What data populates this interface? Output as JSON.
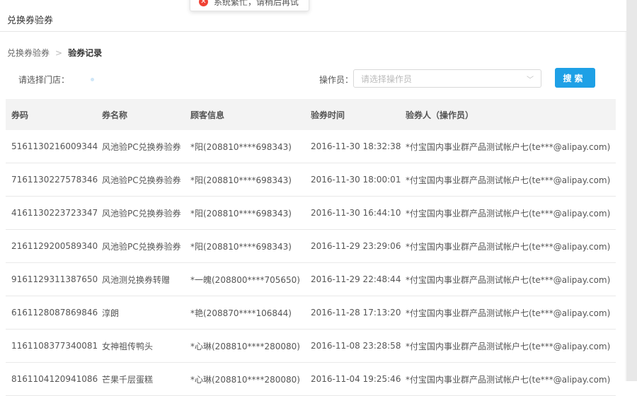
{
  "page": {
    "title": "兑换券验券",
    "toast": {
      "icon": "error-icon",
      "message": "系统繁忙，请稍后再试"
    }
  },
  "breadcrumb": {
    "parent": "兑换券验券",
    "separator": ">",
    "current": "验券记录"
  },
  "filters": {
    "store_label": "请选择门店：",
    "operator_label": "操作员：",
    "operator_placeholder": "请选择操作员",
    "search_label": "搜索"
  },
  "table": {
    "columns": [
      "券码",
      "券名称",
      "顾客信息",
      "验券时间",
      "验券人（操作员）"
    ],
    "rows": [
      [
        "5161130216009344",
        "风池验PC兑换券验券",
        "*阳(208810****698343)",
        "2016-11-30 18:32:38",
        "*付宝国内事业群产品测试帐户七(te***@alipay.com)"
      ],
      [
        "7161130227578346",
        "风池验PC兑换券验券",
        "*阳(208810****698343)",
        "2016-11-30 18:00:01",
        "*付宝国内事业群产品测试帐户七(te***@alipay.com)"
      ],
      [
        "4161130223723347",
        "风池验PC兑换券验券",
        "*阳(208810****698343)",
        "2016-11-30 16:44:10",
        "*付宝国内事业群产品测试帐户七(te***@alipay.com)"
      ],
      [
        "2161129200589340",
        "风池验PC兑换券验券",
        "*阳(208810****698343)",
        "2016-11-29 23:29:06",
        "*付宝国内事业群产品测试帐户七(te***@alipay.com)"
      ],
      [
        "9161129311387650",
        "风池测兑换券转赠",
        "*一魄(208800****705650)",
        "2016-11-29 22:48:44",
        "*付宝国内事业群产品测试帐户七(te***@alipay.com)"
      ],
      [
        "6161128087869846",
        "淳朗",
        "*艳(208870****106844)",
        "2016-11-28 17:13:20",
        "*付宝国内事业群产品测试帐户七(te***@alipay.com)"
      ],
      [
        "1161108377340081",
        "女神祖传鸭头",
        "*心琳(208810****280080)",
        "2016-11-08 23:28:58",
        "*付宝国内事业群产品测试帐户七(te***@alipay.com)"
      ],
      [
        "8161104120941086",
        "芒果千层蛋糕",
        "*心琳(208810****280080)",
        "2016-11-04 19:25:46",
        "*付宝国内事业群产品测试帐户七(te***@alipay.com)"
      ]
    ]
  }
}
